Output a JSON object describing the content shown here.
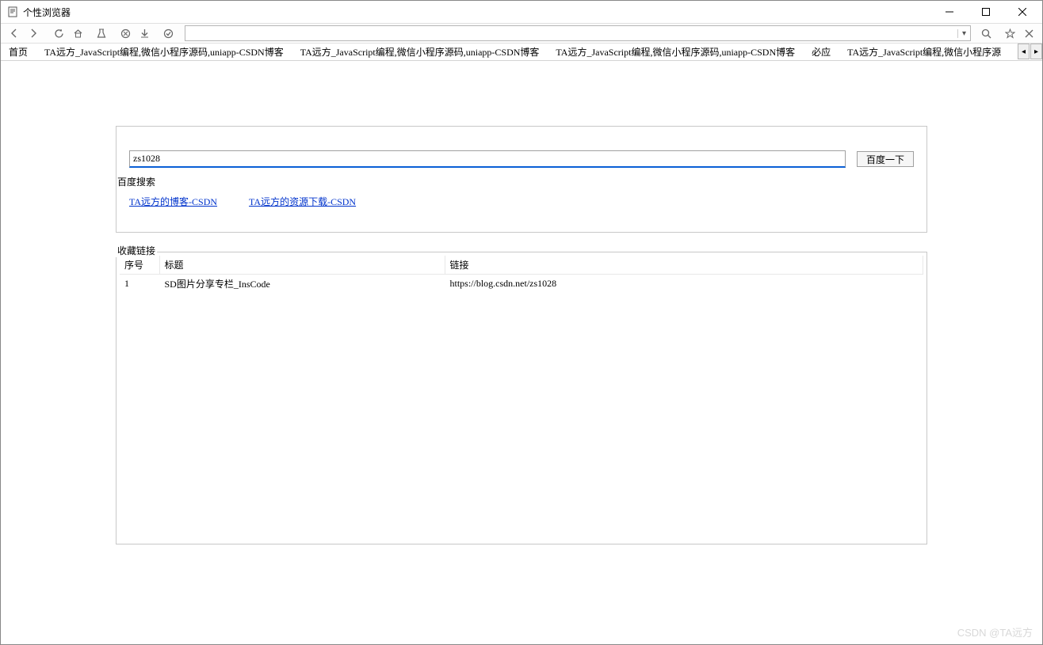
{
  "window": {
    "title": "个性浏览器"
  },
  "toolbar": {
    "address_value": "",
    "icons": {
      "back": "back-icon",
      "forward": "forward-icon",
      "refresh": "refresh-icon",
      "home": "home-icon",
      "lab": "lab-icon",
      "cancel": "cancel-icon",
      "download": "download-icon",
      "check": "check-icon",
      "search": "search-icon",
      "star": "star-icon",
      "close": "close-icon"
    }
  },
  "tabs": [
    {
      "label": "首页"
    },
    {
      "label": "TA远方_JavaScript编程,微信小程序源码,uniapp-CSDN博客"
    },
    {
      "label": "TA远方_JavaScript编程,微信小程序源码,uniapp-CSDN博客"
    },
    {
      "label": "TA远方_JavaScript编程,微信小程序源码,uniapp-CSDN博客"
    },
    {
      "label": "必应"
    },
    {
      "label": "TA远方_JavaScript编程,微信小程序源"
    }
  ],
  "search": {
    "legend": "百度搜索",
    "input_value": "zs1028",
    "button_label": "百度一下",
    "links": [
      {
        "label": "TA远方的博客-CSDN"
      },
      {
        "label": "TA远方的资源下载-CSDN"
      }
    ]
  },
  "favorites": {
    "legend": "收藏链接",
    "columns": {
      "index": "序号",
      "title": "标题",
      "link": "链接"
    },
    "rows": [
      {
        "index": "1",
        "title": "SD图片分享专栏_InsCode",
        "link": "https://blog.csdn.net/zs1028"
      }
    ]
  },
  "watermark": "CSDN @TA远方"
}
